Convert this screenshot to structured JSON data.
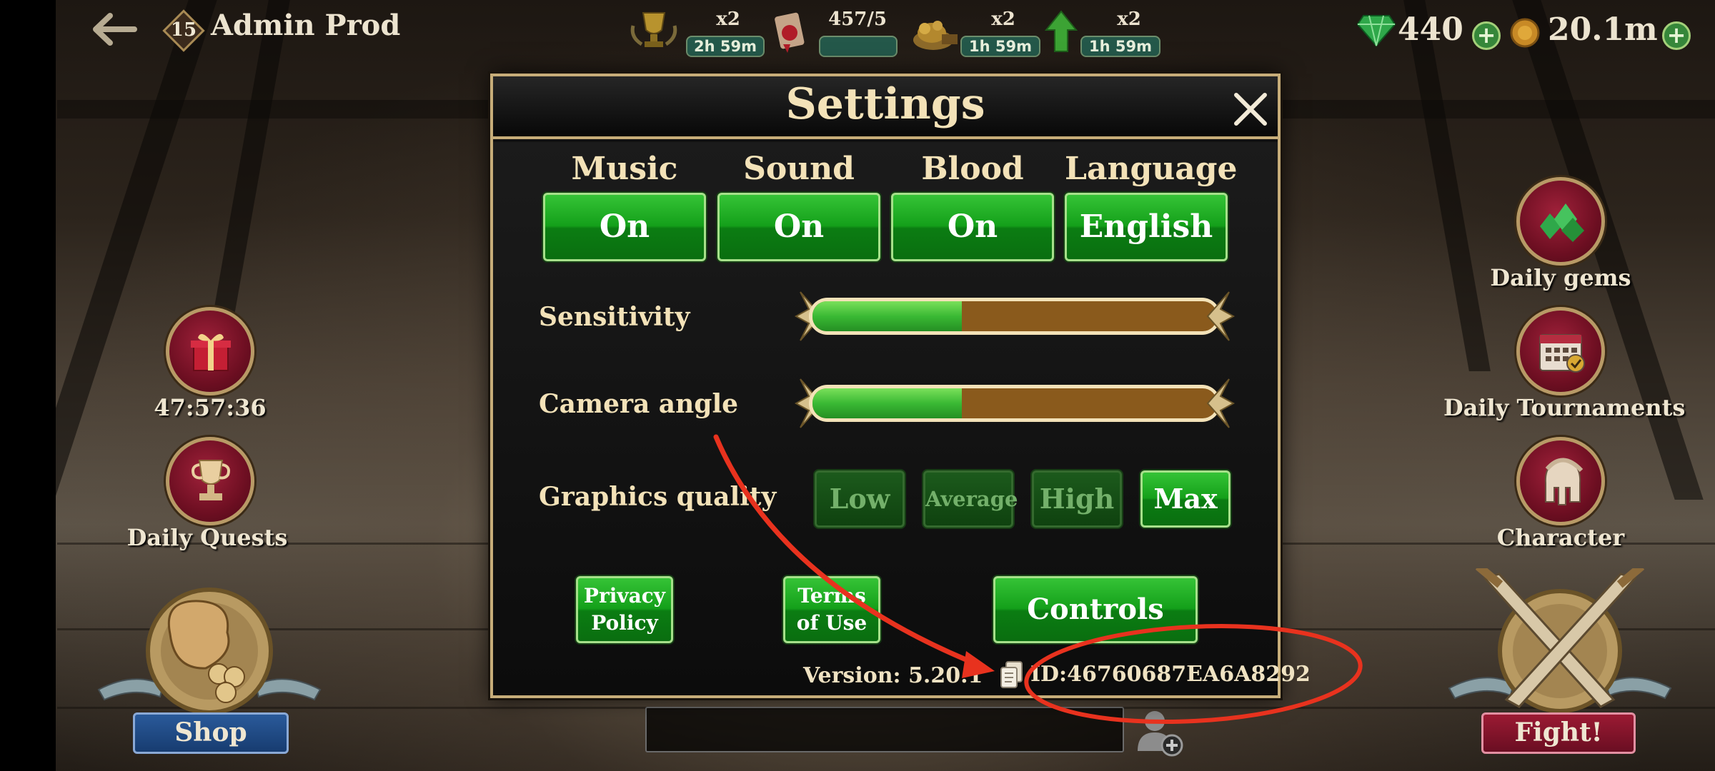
{
  "header": {
    "player_name": "Admin Prod",
    "level": "15"
  },
  "boosts": [
    {
      "icon": "trophy-icon",
      "multiplier": "x2",
      "timer": "2h 59m"
    },
    {
      "icon": "scroll-icon",
      "multiplier": "457/5",
      "timer": ""
    },
    {
      "icon": "treasure-icon",
      "multiplier": "x2",
      "timer": "1h 59m"
    },
    {
      "icon": "green-arrow-up-icon",
      "multiplier": "x2",
      "timer": "1h 59m"
    }
  ],
  "currency": {
    "gems": "440",
    "gold": "20.1m"
  },
  "left_widgets": {
    "gift_timer": "47:57:36",
    "daily_quests": "Daily Quests",
    "shop": "Shop"
  },
  "right_widgets": {
    "daily_gems": "Daily gems",
    "daily_tournaments": "Daily Tournaments",
    "character": "Character",
    "fight": "Fight!"
  },
  "settings": {
    "title": "Settings",
    "toggles": [
      {
        "label": "Music",
        "value": "On"
      },
      {
        "label": "Sound",
        "value": "On"
      },
      {
        "label": "Blood",
        "value": "On"
      },
      {
        "label": "Language",
        "value": "English"
      }
    ],
    "sensitivity": {
      "label": "Sensitivity",
      "level": 0.37
    },
    "camera_angle": {
      "label": "Camera angle",
      "level": 0.37
    },
    "graphics": {
      "label": "Graphics quality",
      "options": [
        "Low",
        "Average",
        "High",
        "Max"
      ],
      "selected": "Max"
    },
    "privacy_policy": [
      "Privacy",
      "Policy"
    ],
    "terms_of_use": [
      "Terms",
      "of Use"
    ],
    "controls": "Controls",
    "version": "Version: 5.20.1",
    "player_id": "ID:46760687EA6A8292"
  },
  "colors": {
    "accent_gold": "#c7ad79",
    "button_green": "#14a01a",
    "annotation_red": "#e8321e"
  }
}
